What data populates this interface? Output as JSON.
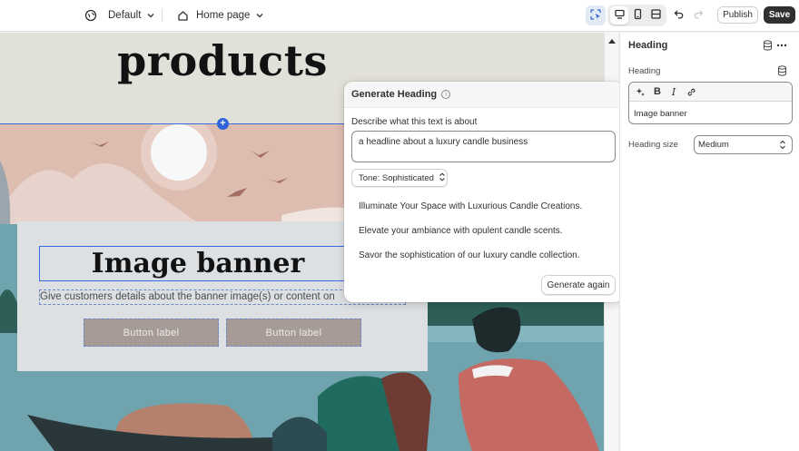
{
  "topbar": {
    "theme_label": "Default",
    "page_label": "Home page",
    "publish_label": "Publish",
    "save_label": "Save"
  },
  "canvas": {
    "products_title": "products",
    "banner_heading": "Image banner",
    "banner_subtext": "Give customers details about the banner image(s) or content on",
    "button_1": "Button label",
    "button_2": "Button label",
    "add_icon": "+"
  },
  "popover": {
    "title": "Generate Heading",
    "describe_label": "Describe what this text is about",
    "describe_value": "a headline about a luxury candle business",
    "tone_label": "Tone: Sophisticated",
    "suggestions": [
      "Illuminate Your Space with Luxurious Candle Creations.",
      "Elevate your ambiance with opulent candle scents.",
      "Savor the sophistication of our luxury candle collection."
    ],
    "generate_again_label": "Generate again",
    "info_glyph": "i"
  },
  "panel": {
    "title": "Heading",
    "heading_label": "Heading",
    "heading_value": "Image banner",
    "heading_size_label": "Heading size",
    "heading_size_value": "Medium",
    "bold_glyph": "B",
    "italic_glyph": "I"
  },
  "icons": {
    "theme": "globe-icon",
    "page": "home-icon",
    "inspector": "select-element-icon",
    "desktop": "desktop-icon",
    "mobile": "mobile-icon",
    "fullwidth": "fullwidth-icon",
    "undo": "undo-icon",
    "redo": "redo-icon",
    "database": "database-icon",
    "more": "more-icon",
    "ai": "ai-sparkle-icon",
    "link": "link-icon"
  },
  "colors": {
    "accent": "#2c63d8",
    "save_bg": "#303030",
    "products_band": "#e2e1d9",
    "banner_box": "#dde0e3"
  }
}
